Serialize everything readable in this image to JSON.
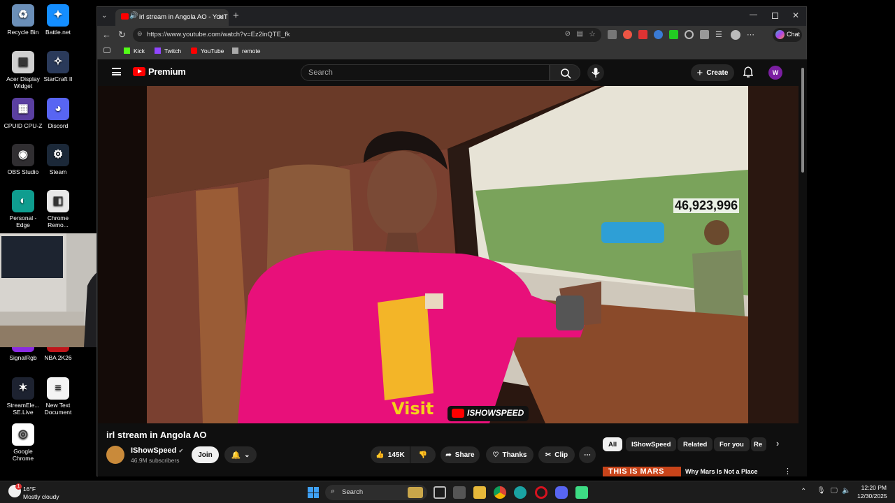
{
  "desktop_icons": [
    {
      "label": "Recycle Bin",
      "color": "#6b8fb8",
      "glyph": "♻"
    },
    {
      "label": "Battle.net",
      "color": "#148eff",
      "glyph": "✦"
    },
    {
      "label": "Acer Display Widget",
      "color": "#cfcfcf",
      "glyph": "▣"
    },
    {
      "label": "StarCraft II",
      "color": "#2a3a5a",
      "glyph": "✧"
    },
    {
      "label": "CPUID CPU-Z",
      "color": "#5a3fa0",
      "glyph": "▦"
    },
    {
      "label": "Discord",
      "color": "#5865f2",
      "glyph": "◕"
    },
    {
      "label": "OBS Studio",
      "color": "#302e31",
      "glyph": "◉"
    },
    {
      "label": "Steam",
      "color": "#1b2838",
      "glyph": "⚙"
    },
    {
      "label": "Personal - Edge",
      "color": "#0f9d8f",
      "glyph": "◐"
    },
    {
      "label": "Chrome Remo...",
      "color": "#e8e8e8",
      "glyph": "◧"
    },
    {
      "label": "SignalRgb",
      "color": "#8a2be2",
      "glyph": "◆"
    },
    {
      "label": "NBA 2K26",
      "color": "#c0161b",
      "glyph": "■"
    },
    {
      "label": "StreamEle... SE.Live",
      "color": "#1d2230",
      "glyph": "✶"
    },
    {
      "label": "New Text Document",
      "color": "#f4f4f4",
      "glyph": "≡"
    },
    {
      "label": "Google Chrome",
      "color": "#ffffff",
      "glyph": "◎"
    }
  ],
  "browser": {
    "tab_title": "irl stream in Angola AO - YouT",
    "url": "https://www.youtube.com/watch?v=Ez2inQTE_fk",
    "chat_label": "Chat",
    "bookmarks": [
      "Kick",
      "Twitch",
      "YouTube",
      "remote"
    ]
  },
  "youtube": {
    "logo_label": "Premium",
    "search_placeholder": "Search",
    "create_label": "Create",
    "avatar_letter": "W",
    "video": {
      "counter": "46,923,996",
      "watermark": "ISHOWSPEED",
      "shirt_text": "Visit"
    },
    "title": "irl stream in Angola AO",
    "channel": {
      "name": "IShowSpeed",
      "subscribers": "46.9M subscribers",
      "join_label": "Join"
    },
    "actions": {
      "likes": "145K",
      "share": "Share",
      "thanks": "Thanks",
      "clip": "Clip"
    },
    "chips": [
      "All",
      "IShowSpeed",
      "Related",
      "For you",
      "Re"
    ],
    "recommended": {
      "thumb_text": "THIS IS MARS",
      "title": "Why Mars Is Not a Place Humans Can Actually Live"
    }
  },
  "taskbar": {
    "weather_temp": "16°F",
    "weather_desc": "Mostly cloudy",
    "weather_badge": "1",
    "search_placeholder": "Search",
    "time": "12:20 PM",
    "date": "12/30/2025"
  },
  "colors": {
    "youtube_red": "#ff0000",
    "shirt_pink": "#e8107a",
    "join_bg": "#f1f1f1"
  }
}
